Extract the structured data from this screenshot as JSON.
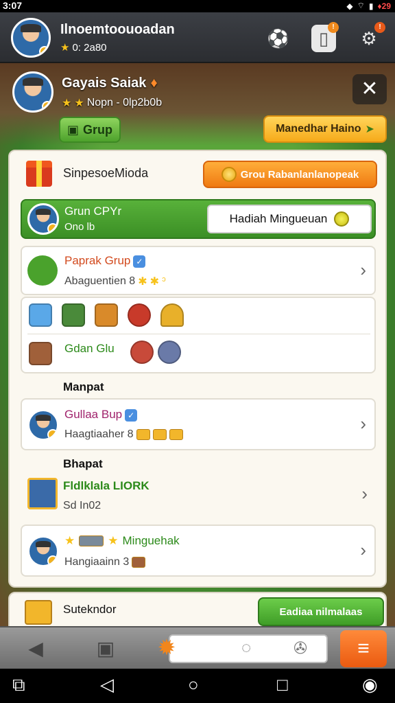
{
  "status": {
    "time": "3:07",
    "battery": "♦29"
  },
  "header": {
    "name": "Ilnoemtoouoadan",
    "score": "0: 2a80",
    "buttons": [
      {
        "icon": "football-icon"
      },
      {
        "icon": "notification-icon",
        "badge": "!"
      },
      {
        "icon": "settings-icon",
        "badge": "!"
      }
    ]
  },
  "profile": {
    "name": "Gayais Saiak",
    "subtitle": "Nopn - 0lp2b0b",
    "grup_button": "Grup",
    "mainkan_button": "Manedhar Haino"
  },
  "panel": {
    "title": "SinpesoeMioda",
    "orange_button": "Grou Rabanlanlanopeak",
    "green_row": {
      "title": "Grun CPYr",
      "subtitle": "Ono lb",
      "pill": "Hadiah Mingueuan"
    },
    "card1": {
      "title": "Paprak Grup",
      "subtitle": "Abaguentien 8"
    },
    "card2": {
      "label": "Gdan Glu"
    },
    "section1": "Manpat",
    "card3": {
      "title": "Gullaa Bup",
      "subtitle": "Haagtiaaher 8"
    },
    "section2": "Bhapat",
    "card4": {
      "title": "Fldlklala LIORK",
      "subtitle": "Sd In02"
    },
    "card5": {
      "title": "Minguehak",
      "subtitle": "Hangiaainn 3"
    }
  },
  "bottom_panel": {
    "title": "Sutekndor",
    "green_button": "Eadiaa nilmalaas"
  },
  "colors": {
    "accent_green": "#4ea22c",
    "accent_orange": "#ef7a12",
    "accent_yellow": "#f6aa1a",
    "title_red": "#d24a1e",
    "title_purple": "#a0236c",
    "title_green": "#2c8a1a"
  }
}
